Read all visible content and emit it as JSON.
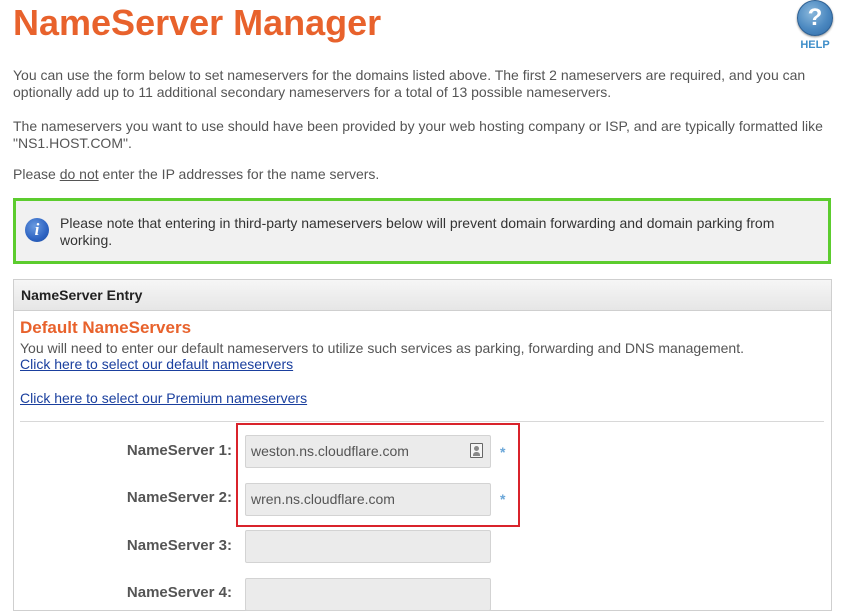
{
  "page": {
    "title": "NameServer Manager",
    "help_label": "HELP",
    "help_icon": "?"
  },
  "intro": {
    "paragraph1": "You can use the form below to set nameservers for the domains listed above. The first 2 nameservers are required, and you can optionally add up to 11 additional secondary nameservers for a total of 13 possible nameservers.",
    "paragraph2": "The nameservers you want to use should have been provided by your web hosting company or ISP, and are typically formatted like \"NS1.HOST.COM\".",
    "paragraph3_before": "Please ",
    "paragraph3_emphasis": "do not",
    "paragraph3_after": " enter the IP addresses for the name servers."
  },
  "notice": {
    "icon": "i",
    "text": "Please note that entering in third-party nameservers below will prevent domain forwarding and domain parking from working."
  },
  "panel": {
    "header": "NameServer Entry",
    "default_title": "Default NameServers",
    "default_desc": "You will need to enter our default nameservers to utilize such services as parking, forwarding and DNS management.",
    "default_link": "Click here to select our default nameservers",
    "premium_link": "Click here to select our Premium nameservers"
  },
  "nameservers": [
    {
      "label": "NameServer 1:",
      "value": "weston.ns.cloudflare.com",
      "required_mark": "*"
    },
    {
      "label": "NameServer 2:",
      "value": "wren.ns.cloudflare.com",
      "required_mark": "*"
    },
    {
      "label": "NameServer 3:",
      "value": ""
    },
    {
      "label": "NameServer 4:",
      "value": ""
    }
  ],
  "colors": {
    "title": "#e8622c",
    "notice_border": "#5ccc2e",
    "highlight_border": "#d9232b",
    "link": "#1a3f9e"
  }
}
